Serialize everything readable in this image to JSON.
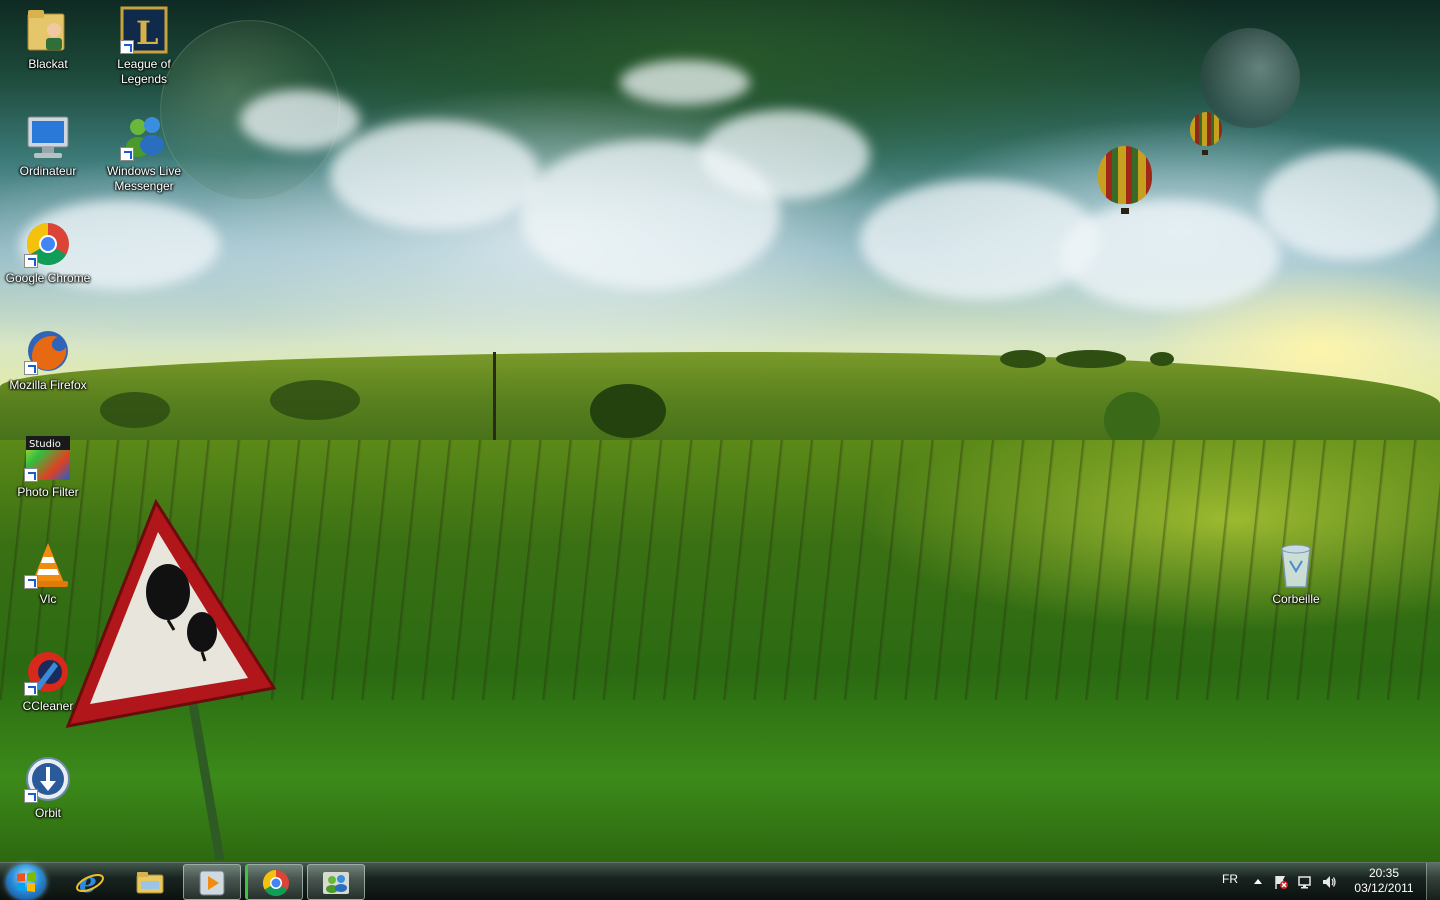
{
  "desktop": {
    "icons": [
      {
        "label": "Blackat",
        "icon": "user-folder-icon"
      },
      {
        "label": "League of Legends",
        "icon": "league-of-legends-icon"
      },
      {
        "label": "Ordinateur",
        "icon": "computer-icon"
      },
      {
        "label": "Windows Live Messenger",
        "icon": "messenger-icon"
      },
      {
        "label": "Google Chrome",
        "icon": "chrome-icon"
      },
      {
        "label": "Mozilla Firefox",
        "icon": "firefox-icon"
      },
      {
        "label": "Photo Filter",
        "icon": "photo-filter-icon",
        "badge": "Studio"
      },
      {
        "label": "Vlc",
        "icon": "vlc-icon"
      },
      {
        "label": "CCleaner",
        "icon": "ccleaner-icon"
      },
      {
        "label": "Orbit",
        "icon": "orbit-icon"
      },
      {
        "label": "Corbeille",
        "icon": "recycle-bin-icon"
      }
    ]
  },
  "taskbar": {
    "start": "start-orb-icon",
    "pinned": [
      {
        "icon": "internet-explorer-icon",
        "state": "pinned"
      },
      {
        "icon": "explorer-folder-icon",
        "state": "pinned"
      },
      {
        "icon": "media-player-icon",
        "state": "running"
      },
      {
        "icon": "chrome-icon",
        "state": "active"
      },
      {
        "icon": "messenger-icon",
        "state": "running"
      }
    ]
  },
  "tray": {
    "language": "FR",
    "time": "20:35",
    "date": "03/12/2011",
    "icons": [
      "show-hidden-icons-icon",
      "action-center-icon",
      "network-icon",
      "volume-icon"
    ]
  },
  "colors": {
    "taskbar": "#141c19",
    "active_indicator": "#3ec43e",
    "start_orb": "#2b8fd8"
  }
}
